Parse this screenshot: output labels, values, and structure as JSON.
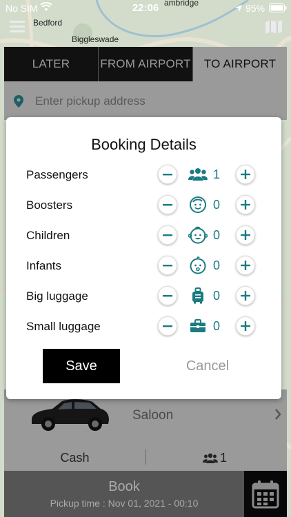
{
  "status_bar": {
    "carrier": "No SIM",
    "time": "22:06",
    "battery": "95%"
  },
  "map": {
    "labels": [
      "Bedford",
      "Biggleswade",
      "ambridge"
    ]
  },
  "tabs": [
    {
      "label": "LATER"
    },
    {
      "label": "FROM AIRPORT"
    },
    {
      "label": "TO AIRPORT"
    }
  ],
  "pickup": {
    "placeholder": "Enter pickup address"
  },
  "modal": {
    "title": "Booking Details",
    "rows": [
      {
        "label": "Passengers",
        "icon": "people-icon",
        "value": "1"
      },
      {
        "label": "Boosters",
        "icon": "child-face-icon",
        "value": "0"
      },
      {
        "label": "Children",
        "icon": "kid-face-icon",
        "value": "0"
      },
      {
        "label": "Infants",
        "icon": "baby-face-icon",
        "value": "0"
      },
      {
        "label": "Big luggage",
        "icon": "suitcase-icon",
        "value": "0"
      },
      {
        "label": "Small luggage",
        "icon": "briefcase-icon",
        "value": "0"
      }
    ],
    "save_label": "Save",
    "cancel_label": "Cancel"
  },
  "vehicle": {
    "label": "Saloon"
  },
  "payment": {
    "method": "Cash",
    "passengers": "1"
  },
  "book": {
    "label": "Book",
    "pickup_time": "Pickup time : Nov 01, 2021 - 00:10"
  },
  "colors": {
    "accent": "#1a7b82",
    "dark": "#111111"
  }
}
